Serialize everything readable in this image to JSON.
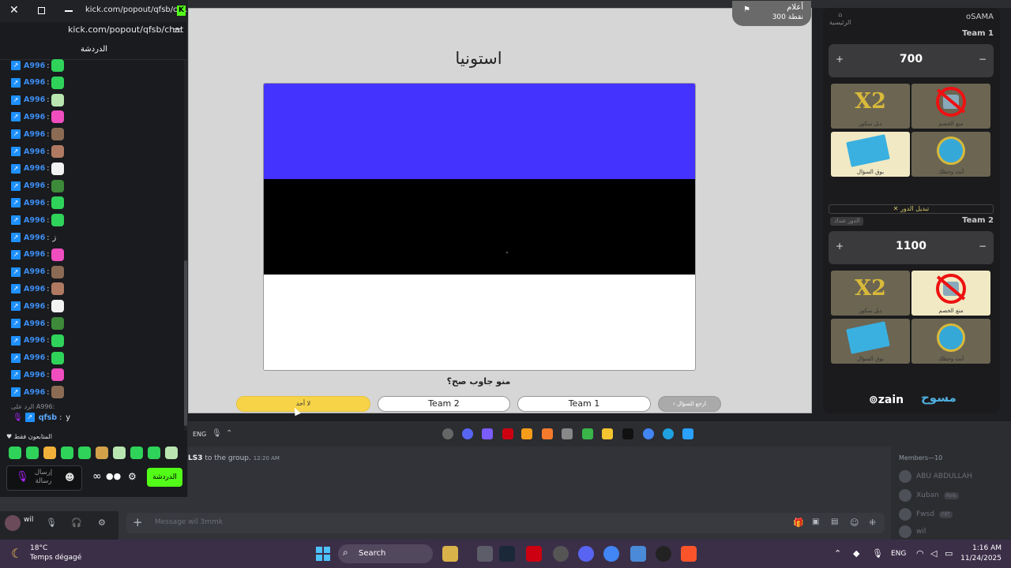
{
  "chat": {
    "url_title": "kick.com/popout/qfsb/ch...",
    "address": "kick.com/popout/qfsb/chat",
    "header": "الدردشة",
    "messages": [
      {
        "user": "A996",
        "emote": "#2fd35a",
        "text": ""
      },
      {
        "user": "A996",
        "emote": "#2fd35a",
        "text": ""
      },
      {
        "user": "A996",
        "emote": "#b9e6b0",
        "text": ""
      },
      {
        "user": "A996",
        "emote": "#f04dbf",
        "text": ""
      },
      {
        "user": "A996",
        "emote": "#8c6b55",
        "text": ""
      },
      {
        "user": "A996",
        "emote": "#b07a62",
        "text": ""
      },
      {
        "user": "A996",
        "emote": "#f2f2f2",
        "text": ""
      },
      {
        "user": "A996",
        "emote": "#3d8a3a",
        "text": ""
      },
      {
        "user": "A996",
        "emote": "#2fd35a",
        "text": ""
      },
      {
        "user": "A996",
        "emote": "#2fd35a",
        "text": ""
      },
      {
        "user": "A996",
        "emote": "",
        "text": "ز"
      },
      {
        "user": "A996",
        "emote": "#f04dbf",
        "text": ""
      },
      {
        "user": "A996",
        "emote": "#8c6b55",
        "text": ""
      },
      {
        "user": "A996",
        "emote": "#b07a62",
        "text": ""
      },
      {
        "user": "A996",
        "emote": "#f2f2f2",
        "text": ""
      },
      {
        "user": "A996",
        "emote": "#3d8a3a",
        "text": ""
      },
      {
        "user": "A996",
        "emote": "#2fd35a",
        "text": ""
      },
      {
        "user": "A996",
        "emote": "#2fd35a",
        "text": ""
      },
      {
        "user": "A996",
        "emote": "#f04dbf",
        "text": ""
      },
      {
        "user": "A996",
        "emote": "#8c6b55",
        "text": ""
      }
    ],
    "reply_line": "الرد على A996:",
    "last_user": "qfsb",
    "last_text": "y",
    "followers_only": "المتابعون فقط",
    "send_placeholder": "إرسال رسالة",
    "send_button": "الدردشة"
  },
  "game": {
    "country": "استونيا",
    "category": "أعلام",
    "points": "300 نقطة",
    "flag_colors": [
      "#4433ff",
      "#000000",
      "#ffffff"
    ],
    "question": "منو جاوب صح؟",
    "buttons": {
      "nobody": "لا أحد",
      "team2": "Team 2",
      "team1": "Team 1",
      "back": "ارجع للسؤال"
    }
  },
  "panel": {
    "home": "الرئيسية",
    "host": "oSAMA",
    "teams": [
      {
        "label": "Team 1",
        "score": "700"
      },
      {
        "label": "Team 2",
        "score": "1100"
      }
    ],
    "cards": {
      "x2": "X2",
      "x2_label": "دبل سكور",
      "ban_label": "منع الخصم",
      "cards_label": "بوق السؤال",
      "wheel_label": "أنت وحظك"
    },
    "switch_turn": "✕ تبديل الدور",
    "turn_badge": "الدور عندك",
    "zain": "zain",
    "brand": "مسوح"
  },
  "discord": {
    "message_user": "LS3",
    "message_text": " to the group.",
    "message_time": "12:20 AM",
    "members_title": "Members—10",
    "members": [
      {
        "name": "ABU ABDULLAH",
        "tag": ""
      },
      {
        "name": "Xuban",
        "tag": "Role"
      },
      {
        "name": "Fwsd",
        "tag": "FRT"
      },
      {
        "name": "wil",
        "tag": ""
      }
    ],
    "user": "wil",
    "message_placeholder": "Message wil 3mmk",
    "tray_lang": "ENG"
  },
  "taskbar": {
    "temp": "18°C",
    "weather": "Temps dégagé",
    "search": "Search",
    "lang": "ENG",
    "time": "1:16 AM",
    "date": "11/24/2025"
  }
}
